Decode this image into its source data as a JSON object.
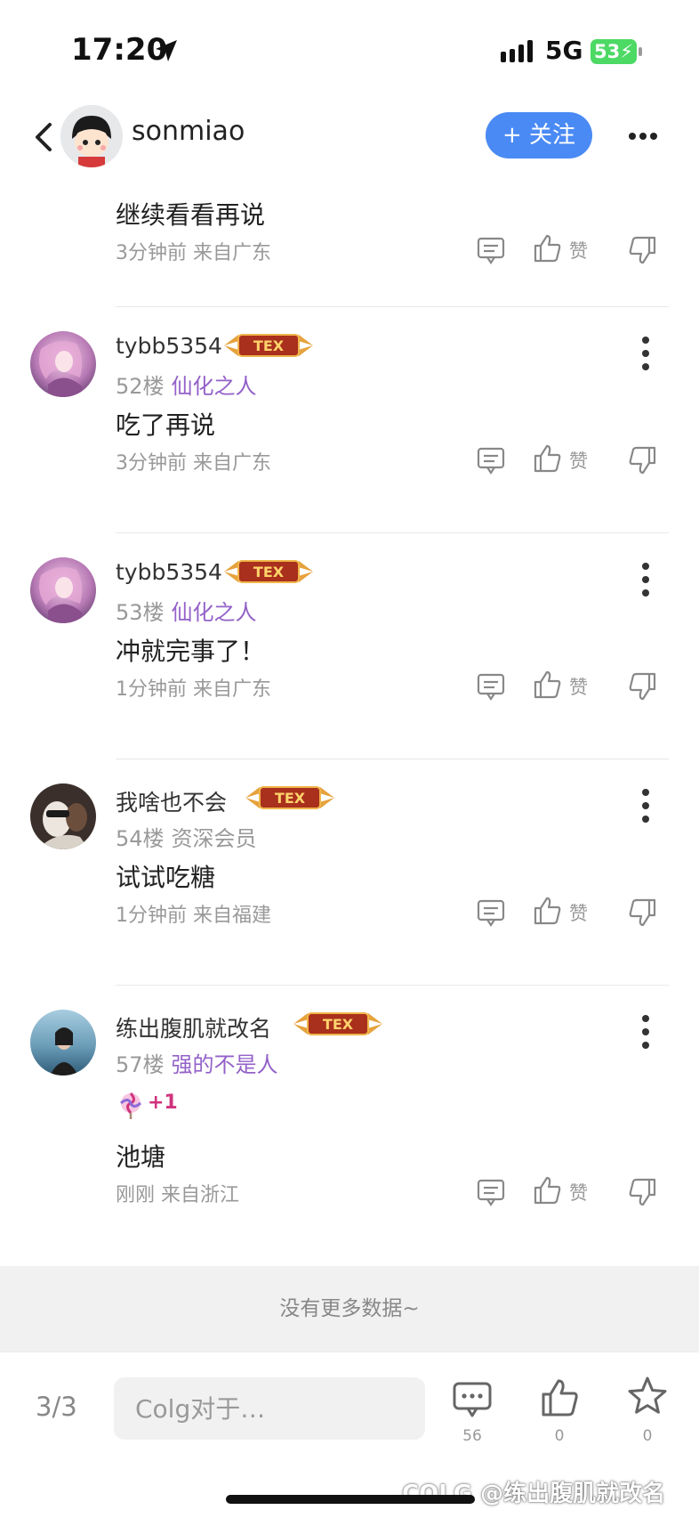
{
  "status_bar": {
    "time": "17:20",
    "network": "5G",
    "battery": "53"
  },
  "header": {
    "username": "sonmiao",
    "follow_label": "+ 关注"
  },
  "top_reply": {
    "text": "继续看看再说",
    "meta": "3分钟前 来自广东",
    "like_label": "赞"
  },
  "comments": [
    {
      "name": "tybb5354",
      "floor": "52楼",
      "title": "仙化之人",
      "text": "吃了再说",
      "meta": "3分钟前 来自广东",
      "like_label": "赞"
    },
    {
      "name": "tybb5354",
      "floor": "53楼",
      "title": "仙化之人",
      "text": "冲就完事了！",
      "meta": "1分钟前 来自广东",
      "like_label": "赞"
    },
    {
      "name": "我啥也不会",
      "floor": "54楼",
      "title": "资深会员",
      "text": "试试吃糖",
      "meta": "1分钟前 来自福建",
      "like_label": "赞"
    },
    {
      "name": "练出腹肌就改名",
      "floor": "57楼",
      "title": "强的不是人",
      "reaction_count": "+1",
      "text": "池塘",
      "meta": "刚刚 来自浙江",
      "like_label": "赞"
    }
  ],
  "badge_text": "TEX",
  "no_more": "没有更多数据~",
  "bottom": {
    "page": "3/3",
    "placeholder": "Colg对于…",
    "comment_count": "56",
    "like_count": "0",
    "fav_count": "0"
  },
  "watermark": "COLG @练出腹肌就改名",
  "colors": {
    "accent": "#4a8af4",
    "title_purple": "#9361c8",
    "battery_green": "#4cd964"
  }
}
